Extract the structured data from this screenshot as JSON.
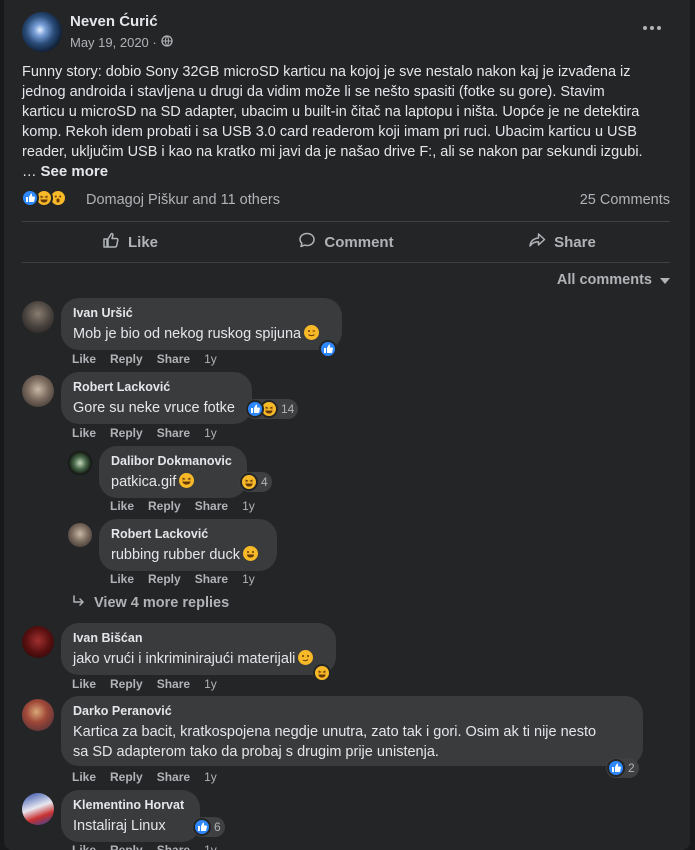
{
  "post": {
    "author": "Neven Ćurić",
    "date": "May 19, 2020 ·",
    "text_lines": [
      "Funny story: dobio Sony 32GB microSD karticu na kojoj je sve nestalo nakon kaj je izvađena iz",
      "jednog androida i stavljena u drugi da vidim može li se nešto spasiti (fotke su gore). Stavim",
      "karticu u microSD na SD adapter, ubacim u built-in čitač na laptopu i ništa. Uopće je ne detektira",
      "komp. Rekoh idem probati i sa USB 3.0 card readerom koji imam pri ruci. Ubacim karticu u USB",
      "reader, uključim USB i kao na kratko mi javi da je našao drive F:, ali se nakon par sekundi izgubi."
    ],
    "ellipsis": "…",
    "see_more": "See more",
    "reactions_text": "Domagoj Piškur and 11 others",
    "comments_count": "25 Comments",
    "more_icon": "more-horizontal-icon",
    "privacy_icon": "globe-icon"
  },
  "actions": {
    "like": "Like",
    "comment": "Comment",
    "share": "Share"
  },
  "filter": {
    "label": "All comments"
  },
  "comment_actions": {
    "like": "Like",
    "reply": "Reply",
    "share": "Share"
  },
  "comments": [
    {
      "name": "Ivan Uršić",
      "text": "Mob je bio od nekog ruskog spijuna",
      "time": "1y",
      "reaction_count": ""
    },
    {
      "name": "Robert Lacković",
      "text": "Gore su neke vruce fotke",
      "time": "1y",
      "reaction_count": "14"
    },
    {
      "name": "Dalibor Dokmanovic",
      "text": "patkica.gif",
      "time": "1y",
      "reaction_count": "4"
    },
    {
      "name": "Robert Lacković",
      "text": "rubbing rubber duck",
      "time": "1y",
      "reaction_count": ""
    },
    {
      "name": "Ivan Bišćan",
      "text": "jako vrući i inkriminirajući materijali",
      "time": "1y",
      "reaction_count": ""
    },
    {
      "name": "Darko Peranović",
      "text_lines": [
        "Kartica za bacit, kratkospojena negdje unutra, zato tak i gori. Osim ak ti nije nesto",
        "sa SD adapterom tako da probaj s drugim prije unistenja."
      ],
      "time": "1y",
      "reaction_count": "2"
    },
    {
      "name": "Klementino Horvat",
      "text": "Instaliraj Linux",
      "time": "1y",
      "reaction_count": "6"
    }
  ],
  "view_more_replies": "View 4 more replies",
  "colors": {
    "background": "#18191a",
    "card": "#242526",
    "bubble": "#3a3b3c",
    "text": "#e4e6eb",
    "secondary_text": "#b0b3b8",
    "like_blue": "#2d88ff",
    "emoji_yellow": "#f7b928"
  }
}
